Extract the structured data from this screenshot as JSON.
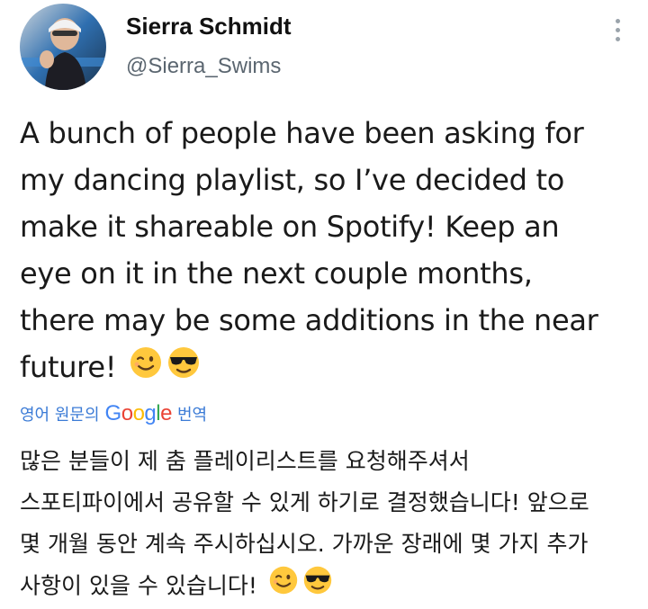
{
  "author": {
    "name": "Sierra Schmidt",
    "handle": "@Sierra_Swims"
  },
  "tweet": {
    "lines": [
      "A bunch of people have been asking for",
      "my dancing playlist, so I’ve decided to",
      "make it shareable on Spotify! Keep an",
      "eye on it in the next couple months,",
      "there may be some additions in the near",
      "future!"
    ],
    "emojis": [
      "winking-face-icon",
      "smiling-face-with-sunglasses-icon"
    ]
  },
  "translation": {
    "prefix": "영어 원문의",
    "brand": "Google",
    "action": "번역",
    "lines": [
      "많은 분들이 제 춤 플레이리스트를 요청해주셔서",
      "스포티파이에서 공유할 수 있게 하기로 결정했습니다! 앞으로",
      "몇 개월 동안 계속 주시하십시오. 가까운 장래에 몇 가지 추가",
      "사항이 있을 수 있습니다!"
    ]
  },
  "colors": {
    "link": "#3b7bd6",
    "handle": "#5b6670",
    "emoji_yellow": "#FFC83D"
  }
}
